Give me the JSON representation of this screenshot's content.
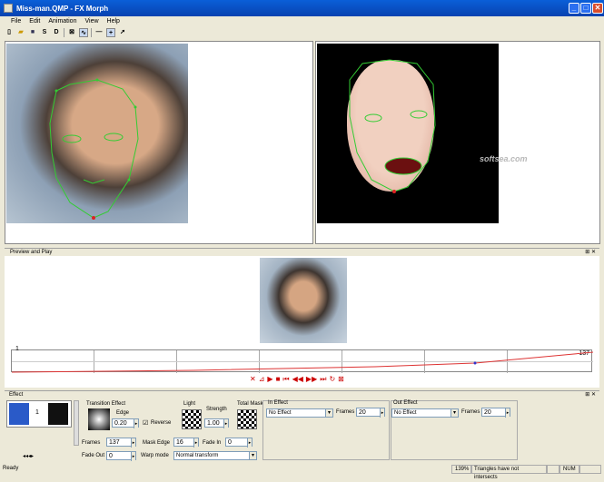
{
  "window": {
    "title": "Miss-man.QMP - FX Morph"
  },
  "menu": [
    "File",
    "Edit",
    "Animation",
    "View",
    "Help"
  ],
  "toolbar": {
    "save_as": "S",
    "d": "D"
  },
  "watermark": "softsea.com",
  "preview": {
    "title": "Preview and Play",
    "frame_start": "1",
    "frame_end": "137"
  },
  "transport": [
    "✕",
    "⊿",
    "▶",
    "■",
    "⏮",
    "◀◀",
    "▶▶",
    "⏭",
    "↻",
    "⊠"
  ],
  "effect": {
    "title": "Effect",
    "thumb_number": "1",
    "transition_label": "Transition Effect",
    "edge_label": "Edge",
    "edge_value": "0.20",
    "reverse_label": "Reverse",
    "light_label": "Light",
    "strength_label": "Strength",
    "strength_value": "1.00",
    "total_mask_label": "Total Mask",
    "frames_label": "Frames",
    "frames_value": "137",
    "mask_edge_label": "Mask Edge",
    "mask_edge_value": "16",
    "fade_in_label": "Fade In",
    "fade_in_value": "0",
    "fade_out_label": "Fade Out",
    "fade_out_value": "0",
    "warp_mode_label": "Warp mode",
    "warp_mode_value": "Normal transform",
    "in_effect_label": "In Effect",
    "in_effect_value": "No Effect",
    "in_frames_label": "Frames",
    "in_frames_value": "20",
    "out_effect_label": "Out Effect",
    "out_effect_value": "No Effect",
    "out_frames_label": "Frames",
    "out_frames_value": "20"
  },
  "status": {
    "ready": "Ready",
    "zoom": "139%",
    "message": "Triangles have not intersects",
    "num": "NUM"
  }
}
